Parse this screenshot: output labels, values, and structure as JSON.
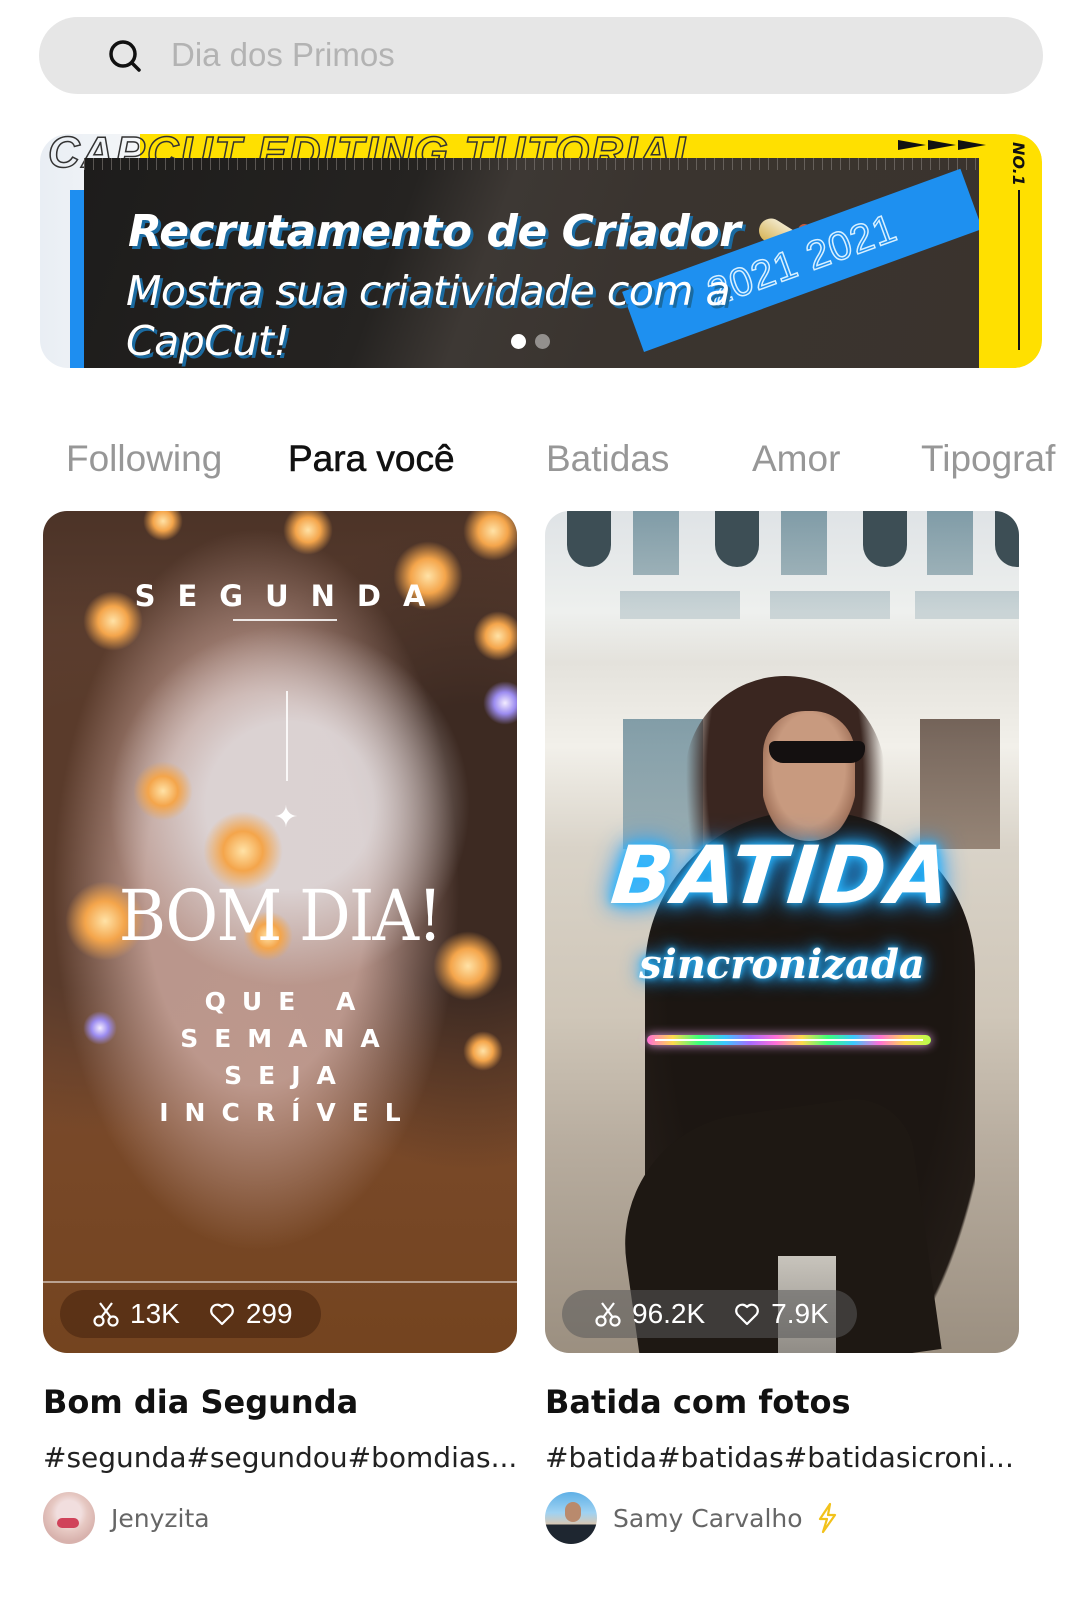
{
  "search": {
    "placeholder": "Dia dos Primos",
    "icon": "search-icon"
  },
  "banner": {
    "top_text": "CAPCUT EDITING TUTORIAL",
    "title": "Recrutamento de Criador",
    "subtitle": "Mostra sua criatividade com a CapCut!",
    "ribbon_text": "2021 2021",
    "badge": "NO.1",
    "page_count": 2,
    "active_page": 1,
    "colors": {
      "yellow": "#ffe000",
      "blue": "#1e8ef0"
    }
  },
  "tabs": [
    {
      "label": "Following",
      "active": false
    },
    {
      "label": "Para você",
      "active": true
    },
    {
      "label": "Batidas",
      "active": false
    },
    {
      "label": "Amor",
      "active": false
    },
    {
      "label": "Tipograf",
      "active": false
    }
  ],
  "cards": [
    {
      "title": "Bom dia Segunda",
      "tags": "#segunda#segundou#bomdias...",
      "author": "Jenyzita",
      "verified": false,
      "uses": "13K",
      "likes": "299",
      "overlay": {
        "top": "SEGUNDA",
        "main": "BOM DIA!",
        "lines": [
          "QUE A",
          "SEMANA",
          "SEJA",
          "INCRÍVEL"
        ]
      }
    },
    {
      "title": "Batida com fotos",
      "tags": "#batida#batidas#batidasicroni...",
      "author": "Samy Carvalho",
      "verified": true,
      "uses": "96.2K",
      "likes": "7.9K",
      "overlay": {
        "main": "BATIDA",
        "sub": "sincronizada"
      }
    }
  ]
}
